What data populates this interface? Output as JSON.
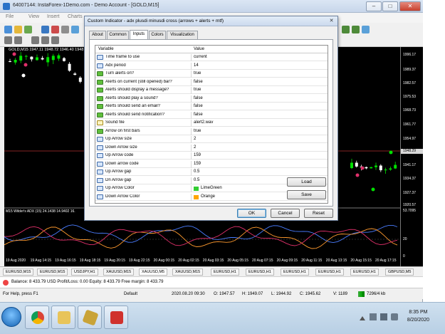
{
  "window": {
    "title": "64007144: InstaForex-1Demo.com - Demo Account - [GOLD,M15]",
    "min_label": "–",
    "max_label": "□",
    "close_label": "✕"
  },
  "menu": [
    "File",
    "View",
    "Insert",
    "Charts"
  ],
  "chart": {
    "symbol_header": "GOLD,M15  1947.11 1948.72 1946.40 1948",
    "price_labels": [
      "1996.17",
      "1989.37",
      "1982.57",
      "1975.53",
      "1968.73",
      "1961.77",
      "1954.97",
      "1941.17",
      "1934.37",
      "1927.37",
      "1920.57",
      "53.7095",
      "20",
      "0"
    ],
    "current_price": "1948.29",
    "adx_title": "M15 Wilder's ADX (15) 24.1438 14.9402 16.",
    "time_labels": [
      "19 Aug 2020",
      "19 Aug 14:15",
      "19 Aug 16:15",
      "19 Aug 18:15",
      "19 Aug 20:15",
      "19 Aug 22:15",
      "20 Aug 00:15",
      "20 Aug 02:15",
      "20 Aug 03:15",
      "20 Aug 05:15",
      "20 Aug 07:15",
      "20 Aug 09:15",
      "20 Aug 11:15",
      "20 Aug 13:15",
      "20 Aug 15:15",
      "20 Aug 17:15"
    ],
    "colors": {
      "bull": "#00e000",
      "bear": "#ffffff",
      "adx_main": "#4a7dff",
      "adx_plus": "#ff9a2e",
      "adx_minus": "#e0306a"
    }
  },
  "tabs": [
    "EURUSD,M15",
    "EURUSD,M15",
    "USDJPY,H1",
    "XAUUSD,M15",
    "XAUUSD,M5",
    "XAUUSD,M15",
    "EURUSD,H1",
    "EURUSD,H1",
    "EURUSD,H1",
    "EURUSD,H1",
    "EURUSD,H1",
    "GBPUSD,M5"
  ],
  "balance_text": "Balance: 8 433.79 USD  Profit/Loss: 0.00  Equity: 8 433.79  Free margin: 8 433.79",
  "status": {
    "help": "For Help, press F1",
    "profile": "Default",
    "time": "2020.08.20 09:30",
    "open": "O: 1947.57",
    "high": "H: 1949.07",
    "low": "L: 1944.92",
    "close": "C: 1945.62",
    "volume": "V: 1189",
    "traffic": "7296/4 kb"
  },
  "taskbar": {
    "time": "8:35 PM",
    "date": "8/20/2020"
  },
  "dialog": {
    "title": "Custom Indicator - adx plusdi minusdi cross (arrows + alerts + mtf)",
    "close_label": "✕",
    "tabs": [
      "About",
      "Common",
      "Inputs",
      "Colors",
      "Visualization"
    ],
    "active_tab": "Inputs",
    "columns": {
      "variable": "Variable",
      "value": "Value"
    },
    "rows": [
      {
        "name": "Time frame to use",
        "value": "current",
        "icon": "num"
      },
      {
        "name": "Adx period",
        "value": "14",
        "icon": "num"
      },
      {
        "name": "Turn alerts on?",
        "value": "true",
        "icon": "bool"
      },
      {
        "name": "Alerts on current (still opened) bar?",
        "value": "false",
        "icon": "bool"
      },
      {
        "name": "Alerts should display a message?",
        "value": "true",
        "icon": "bool"
      },
      {
        "name": "Alerts should play a sound?",
        "value": "false",
        "icon": "bool"
      },
      {
        "name": "Alerts should send an email?",
        "value": "false",
        "icon": "bool"
      },
      {
        "name": "Alerts should send notification?",
        "value": "false",
        "icon": "bool"
      },
      {
        "name": "Sound file",
        "value": "alert2.wav",
        "icon": "abc"
      },
      {
        "name": "Arrow on first bars",
        "value": "true",
        "icon": "bool"
      },
      {
        "name": "Up Arrow size",
        "value": "2",
        "icon": "num"
      },
      {
        "name": "Down Arrow size",
        "value": "2",
        "icon": "num"
      },
      {
        "name": "Up Arrow code",
        "value": "159",
        "icon": "num"
      },
      {
        "name": "Down arrow code",
        "value": "159",
        "icon": "num"
      },
      {
        "name": "Up Arrow gap",
        "value": "0.5",
        "icon": "num"
      },
      {
        "name": "Dn Arrow gap",
        "value": "0.5",
        "icon": "num"
      },
      {
        "name": "Up Arrow Color",
        "value": "LimeGreen",
        "icon": "num",
        "swatch": "#32cd32"
      },
      {
        "name": "Down Arrow Color",
        "value": "Orange",
        "icon": "num",
        "swatch": "#ffa500"
      }
    ],
    "buttons": {
      "load": "Load",
      "save": "Save",
      "ok": "OK",
      "cancel": "Cancel",
      "reset": "Reset"
    }
  }
}
